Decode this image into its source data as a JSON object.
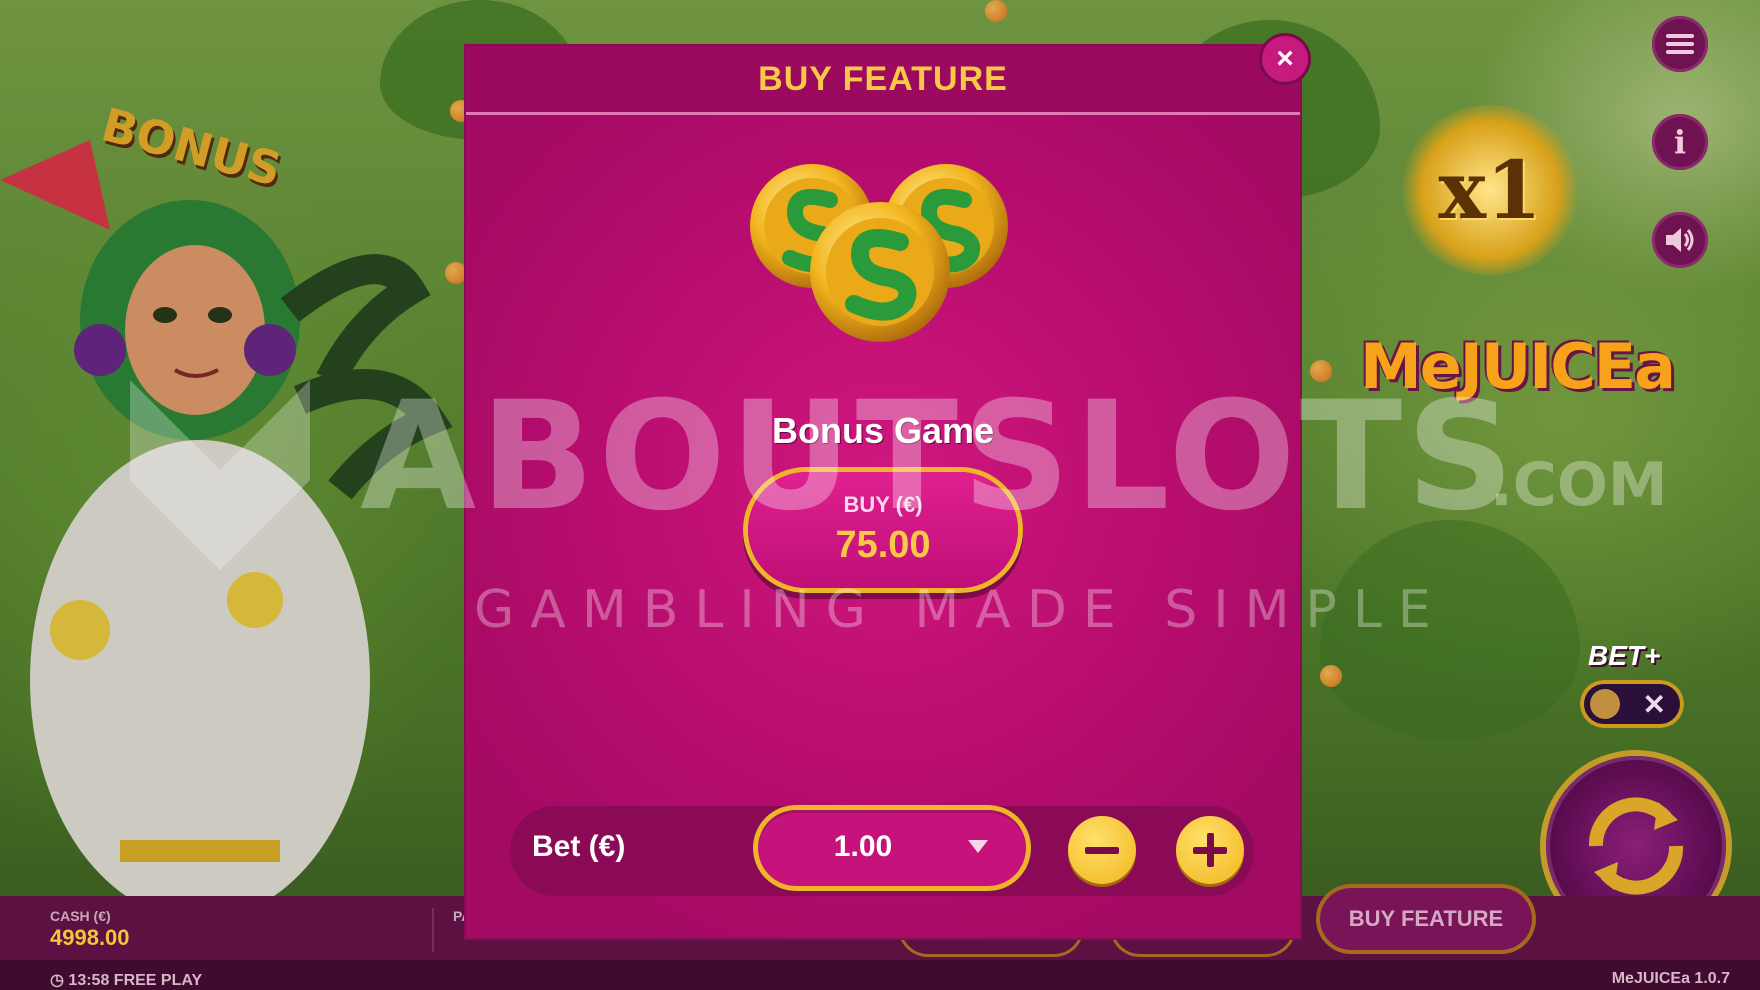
{
  "modal": {
    "title": "BUY FEATURE",
    "close_label": "×",
    "feature_name": "Bonus Game",
    "buy_label": "BUY (€)",
    "buy_price": "75.00",
    "bet_label": "Bet (€)",
    "bet_value": "1.00"
  },
  "game": {
    "multiplier": "x1",
    "logo": "MeJUICEa",
    "bonus_badge": "BONUS",
    "bet_plus_label": "BET+",
    "bet_plus_off": "✕",
    "buy_feature_button": "BUY FEATURE"
  },
  "bottom_bar": {
    "cash_label": "CASH (€)",
    "cash_value": "4998.00",
    "pa_label": "PA",
    "clock": "13:58 FREE PLAY",
    "version": "MeJUICEa 1.0.7"
  },
  "watermark": {
    "main": "ABOUTSLOTS",
    "com": ".COM",
    "tagline": "GAMBLING MADE SIMPLE"
  },
  "icons": [
    "menu-icon",
    "info-icon",
    "sound-icon",
    "spin-icon",
    "close-icon",
    "minus-icon",
    "plus-icon",
    "dropdown-caret-icon",
    "snake-coin-icon"
  ],
  "colors": {
    "modal_bg": "#b80d6f",
    "gold": "#f7c947",
    "border_gold": "#f0b32c",
    "bar": "#5b1141"
  }
}
